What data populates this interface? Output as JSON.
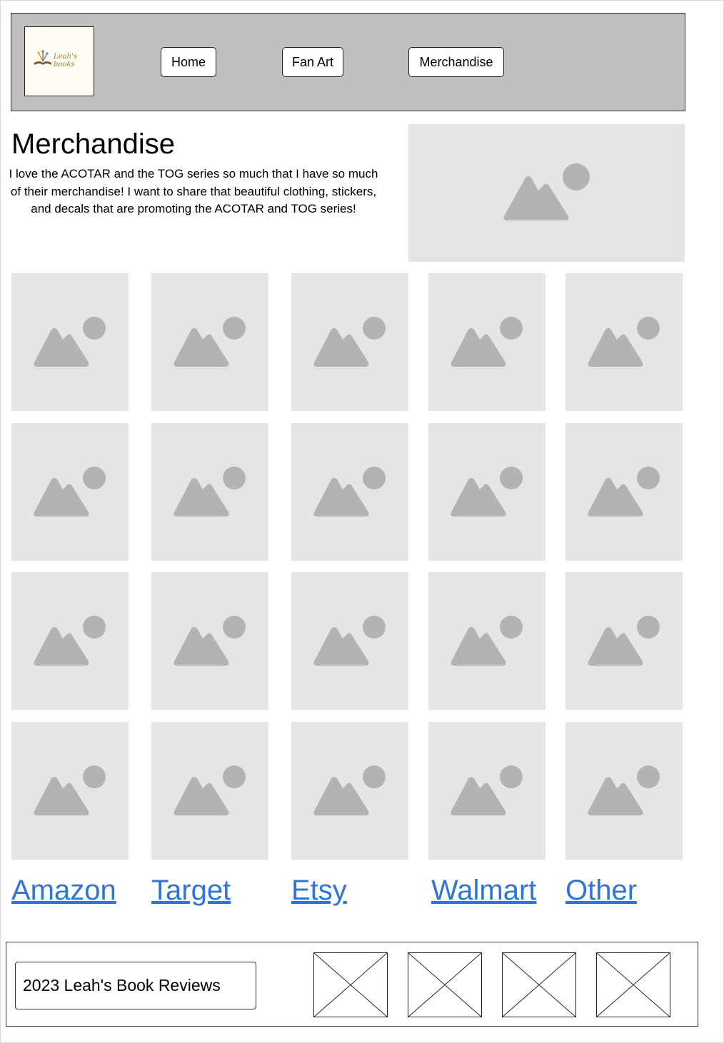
{
  "header": {
    "logo": {
      "text_line1": "Leah's",
      "text_line2": "books"
    },
    "nav": [
      {
        "label": "Home"
      },
      {
        "label": "Fan Art"
      },
      {
        "label": "Merchandise"
      }
    ]
  },
  "main": {
    "title": "Merchandise",
    "intro": "I love the ACOTAR and the TOG series so much that I have so much of their merchandise! I want to share that beautiful clothing, stickers, and decals that are promoting the ACOTAR and TOG series!",
    "hero_image": {
      "icon": "image-placeholder-icon"
    },
    "grid": {
      "rows": 4,
      "columns": 5,
      "icon": "image-placeholder-icon"
    }
  },
  "shops": [
    {
      "label": "Amazon"
    },
    {
      "label": "Target"
    },
    {
      "label": "Etsy"
    },
    {
      "label": "Walmart"
    },
    {
      "label": "Other"
    }
  ],
  "footer": {
    "copyright": "2023 Leah's Book Reviews",
    "social_icons": [
      "image-placeholder-x-icon",
      "image-placeholder-x-icon",
      "image-placeholder-x-icon",
      "image-placeholder-x-icon"
    ]
  },
  "colors": {
    "header_bg": "#c0c0c0",
    "placeholder_bg": "#e5e5e5",
    "placeholder_icon": "#b3b3b3",
    "link": "#2f74d6"
  }
}
